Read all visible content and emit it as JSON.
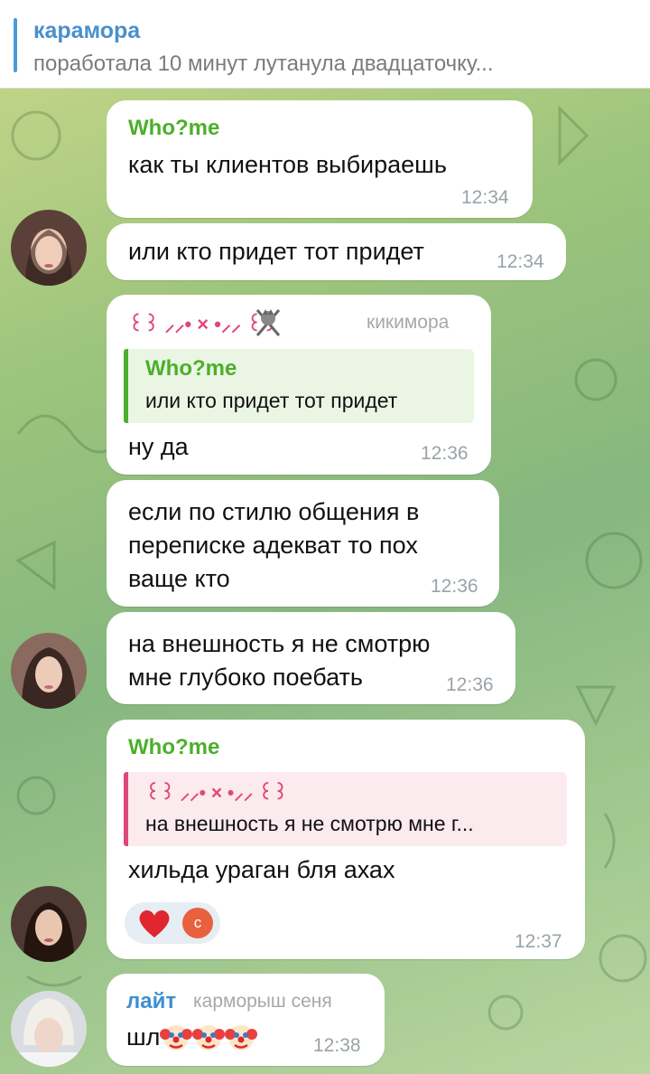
{
  "pinned": {
    "title": "карамора",
    "text": "поработала 10 минут лутанула двадцаточку..."
  },
  "colors": {
    "green_name": "#4caf2b",
    "pink_name": "#e0467a",
    "blue_name": "#3d8fd0",
    "admin_gray": "#a8a8a8"
  },
  "messages": [
    {
      "sender": "Who?me",
      "text": "как ты клиентов выбираешь",
      "time": "12:34"
    },
    {
      "text": "или кто придет тот придет",
      "time": "12:34"
    },
    {
      "sender": "꒰꒱ ⸝⸝• × •⸝⸝ ꒰꒱",
      "role": "кикимора",
      "quote": {
        "author": "Who?me",
        "text": "или кто придет тот придет"
      },
      "text": "ну да",
      "time": "12:36"
    },
    {
      "text_lines": [
        "если по стилю общения в",
        "переписке адекват то пох",
        "ваще кто"
      ],
      "time": "12:36"
    },
    {
      "text_lines": [
        "на внешность я не смотрю",
        "мне глубоко поебать"
      ],
      "time": "12:36"
    },
    {
      "sender": "Who?me",
      "quote": {
        "author": "꒰꒱ ⸝⸝• × •⸝⸝ ꒰꒱",
        "text": "на внешность я не смотрю мне г..."
      },
      "text": "хильда ураган бля ахах",
      "time": "12:37",
      "reactions": {
        "emoji": "heart",
        "avatar_letter": "с"
      }
    },
    {
      "sender": "лайт",
      "role": "карморыш сеня",
      "text": "шл🤡🤡🤡",
      "time": "12:38"
    }
  ],
  "icons": [
    "sword-emoji-icon",
    "heart-reaction-icon",
    "clown-emoji-icon"
  ]
}
